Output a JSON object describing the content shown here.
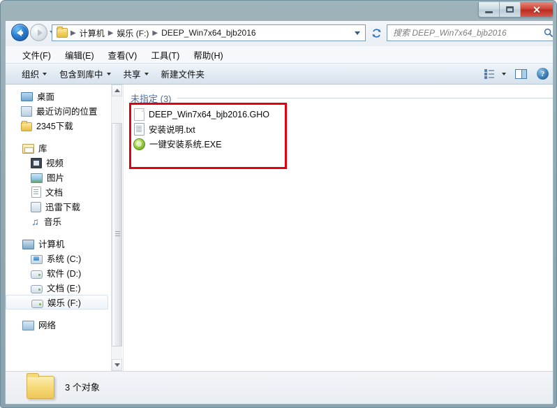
{
  "window": {
    "controls": {
      "minimize_label": "—",
      "maximize_label": "",
      "close_label": "✕"
    }
  },
  "address_bar": {
    "back_tooltip": "后退",
    "forward_tooltip": "前进",
    "breadcrumbs": [
      "计算机",
      "娱乐 (F:)",
      "DEEP_Win7x64_bjb2016"
    ],
    "separator": "▶",
    "refresh_label": "↻"
  },
  "search": {
    "placeholder": "搜索 DEEP_Win7x64_bjb2016",
    "value": "",
    "icon": "search-icon"
  },
  "menubar": {
    "items": [
      {
        "label": "文件(F)"
      },
      {
        "label": "编辑(E)"
      },
      {
        "label": "查看(V)"
      },
      {
        "label": "工具(T)"
      },
      {
        "label": "帮助(H)"
      }
    ]
  },
  "toolbar": {
    "items": [
      {
        "label": "组织",
        "has_caret": true
      },
      {
        "label": "包含到库中",
        "has_caret": true
      },
      {
        "label": "共享",
        "has_caret": true
      },
      {
        "label": "新建文件夹",
        "has_caret": false
      }
    ],
    "view_icon": "view-layout-icon",
    "pane_icon": "preview-pane-icon",
    "help_icon": "help-icon",
    "help_glyph": "?"
  },
  "navigation_pane": {
    "items": [
      {
        "label": "桌面",
        "icon": "desktop-icon",
        "level": 1,
        "selected": false
      },
      {
        "label": "最近访问的位置",
        "icon": "recent-places-icon",
        "level": 1,
        "selected": false
      },
      {
        "label": "2345下载",
        "icon": "folder-icon",
        "level": 1,
        "selected": false
      },
      {
        "gap": true
      },
      {
        "label": "库",
        "icon": "library-icon",
        "level": 0,
        "selected": false
      },
      {
        "label": "视频",
        "icon": "video-icon",
        "level": 1,
        "selected": false
      },
      {
        "label": "图片",
        "icon": "pictures-icon",
        "level": 1,
        "selected": false
      },
      {
        "label": "文档",
        "icon": "documents-icon",
        "level": 1,
        "selected": false
      },
      {
        "label": "迅雷下载",
        "icon": "xunlei-download-icon",
        "level": 1,
        "selected": false
      },
      {
        "label": "音乐",
        "icon": "music-icon",
        "level": 1,
        "selected": false
      },
      {
        "gap": true
      },
      {
        "label": "计算机",
        "icon": "computer-icon",
        "level": 0,
        "selected": false
      },
      {
        "label": "系统 (C:)",
        "icon": "system-drive-icon",
        "level": 1,
        "selected": false
      },
      {
        "label": "软件 (D:)",
        "icon": "drive-icon",
        "level": 1,
        "selected": false
      },
      {
        "label": "文档 (E:)",
        "icon": "drive-icon",
        "level": 1,
        "selected": false
      },
      {
        "label": "娱乐 (F:)",
        "icon": "drive-icon",
        "level": 1,
        "selected": true
      },
      {
        "gap": true
      },
      {
        "label": "网络",
        "icon": "network-icon",
        "level": 0,
        "selected": false
      }
    ]
  },
  "file_pane": {
    "group_header": "未指定 (3)",
    "highlight_color": "#e3000f",
    "files": [
      {
        "name": "DEEP_Win7x64_bjb2016.GHO",
        "icon": "generic-file-icon"
      },
      {
        "name": "安装说明.txt",
        "icon": "text-file-icon"
      },
      {
        "name": "一键安装系统.EXE",
        "icon": "executable-icon"
      }
    ]
  },
  "status_bar": {
    "text": "3 个对象",
    "icon": "folder-large-icon"
  },
  "colors": {
    "frame": "#8fa5ae",
    "accent": "#2a7fd4",
    "group_header": "#4a6ea8",
    "highlight": "#e3000f",
    "close_button": "#cf4436"
  }
}
